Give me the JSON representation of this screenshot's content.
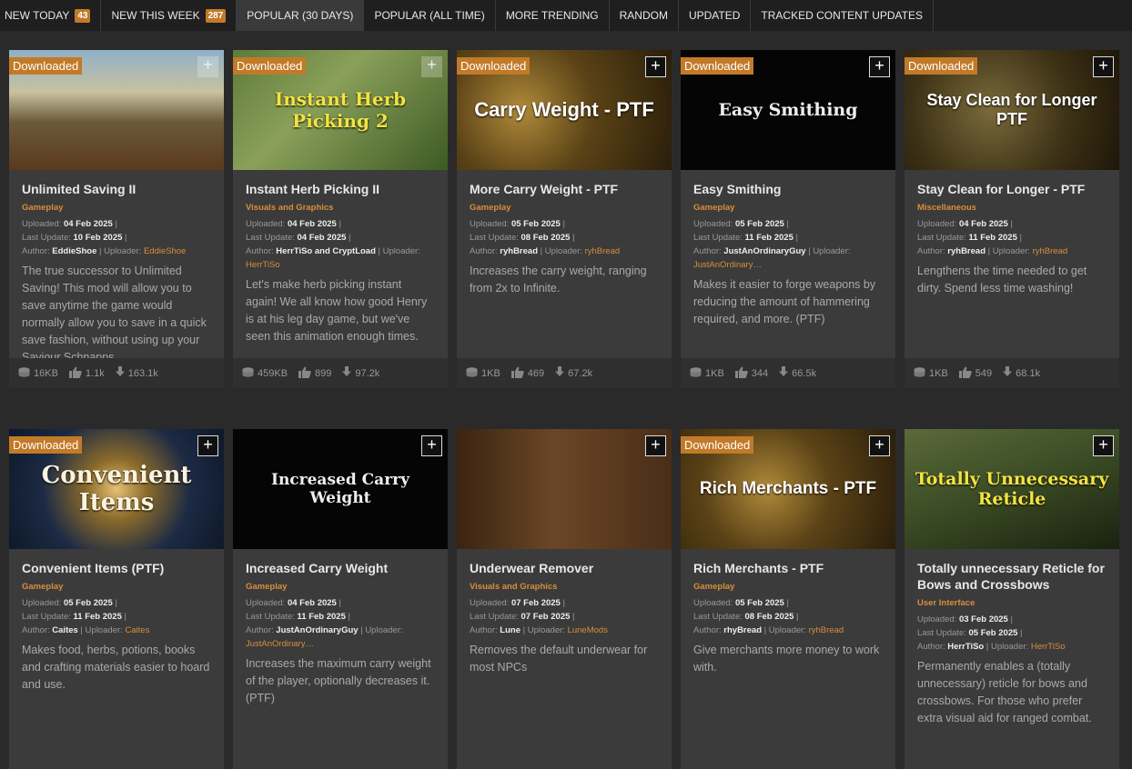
{
  "tabs": [
    {
      "label": "NEW TODAY",
      "badge": "43"
    },
    {
      "label": "NEW THIS WEEK",
      "badge": "287"
    },
    {
      "label": "POPULAR (30 DAYS)",
      "active": true
    },
    {
      "label": "POPULAR (ALL TIME)"
    },
    {
      "label": "MORE TRENDING"
    },
    {
      "label": "RANDOM"
    },
    {
      "label": "UPDATED"
    },
    {
      "label": "TRACKED CONTENT UPDATES"
    }
  ],
  "labels": {
    "downloaded": "Downloaded",
    "uploaded": "Uploaded:",
    "last_update": "Last Update:",
    "author": "Author:",
    "uploader": "Uploader:",
    "plus": "+"
  },
  "cards": [
    {
      "title": "Unlimited Saving II",
      "thumb_text": "",
      "category": "Gameplay",
      "uploaded": "04 Feb 2025",
      "updated": "10 Feb 2025",
      "author": "EddieShoe",
      "uploader": "EddieShoe",
      "desc": "The true successor to Unlimited Saving! This mod will allow you to save anytime the game would normally allow you to save in a quick save fashion, without using up your Saviour Schnapps.",
      "size": "16KB",
      "likes": "1.1k",
      "downloads": "163.1k",
      "downloaded": true
    },
    {
      "title": "Instant Herb Picking II",
      "thumb_text": "Instant Herb Picking 2",
      "category": "Visuals and Graphics",
      "uploaded": "04 Feb 2025",
      "updated": "04 Feb 2025",
      "author": "HerrTiSo and CryptLoad",
      "uploader": "HerrTiSo",
      "desc": "Let's make herb picking instant again! We all know how good Henry is at his leg day game, but we've seen this animation enough times.",
      "size": "459KB",
      "likes": "899",
      "downloads": "97.2k",
      "downloaded": true
    },
    {
      "title": "More Carry Weight - PTF",
      "thumb_text": "Carry Weight - PTF",
      "category": "Gameplay",
      "uploaded": "05 Feb 2025",
      "updated": "08 Feb 2025",
      "author": "ryhBread",
      "uploader": "ryhBread",
      "desc": "Increases the carry weight, ranging from 2x to Infinite.",
      "size": "1KB",
      "likes": "469",
      "downloads": "67.2k",
      "downloaded": true
    },
    {
      "title": "Easy Smithing",
      "thumb_text": "Easy Smithing",
      "category": "Gameplay",
      "uploaded": "05 Feb 2025",
      "updated": "11 Feb 2025",
      "author": "JustAnOrdinaryGuy",
      "uploader": "JustAnOrdinary…",
      "desc": "Makes it easier to forge weapons by reducing the amount of hammering required, and more. (PTF)",
      "size": "1KB",
      "likes": "344",
      "downloads": "66.5k",
      "downloaded": true
    },
    {
      "title": "Stay Clean for Longer - PTF",
      "thumb_text": "Stay Clean for Longer PTF",
      "category": "Miscellaneous",
      "uploaded": "04 Feb 2025",
      "updated": "11 Feb 2025",
      "author": "ryhBread",
      "uploader": "ryhBread",
      "desc": "Lengthens the time needed to get dirty. Spend less time washing!",
      "size": "1KB",
      "likes": "549",
      "downloads": "68.1k",
      "downloaded": true
    },
    {
      "title": "Convenient Items (PTF)",
      "thumb_text": "Convenient Items",
      "category": "Gameplay",
      "uploaded": "05 Feb 2025",
      "updated": "11 Feb 2025",
      "author": "Caites",
      "uploader": "Caites",
      "desc": "Makes food, herbs, potions, books and crafting materials easier to hoard and use.",
      "downloaded": true
    },
    {
      "title": "Increased Carry Weight",
      "thumb_text": "Increased Carry Weight",
      "category": "Gameplay",
      "uploaded": "04 Feb 2025",
      "updated": "11 Feb 2025",
      "author": "JustAnOrdinaryGuy",
      "uploader": "JustAnOrdinary…",
      "desc": "Increases the maximum carry weight of the player, optionally decreases it. (PTF)",
      "downloaded": false
    },
    {
      "title": "Underwear Remover",
      "thumb_text": "",
      "category": "Visuals and Graphics",
      "uploaded": "07 Feb 2025",
      "updated": "07 Feb 2025",
      "author": "Lune",
      "uploader": "LuneMods",
      "desc": "Removes the default underwear for most NPCs",
      "downloaded": false
    },
    {
      "title": "Rich Merchants - PTF",
      "thumb_text": "Rich Merchants - PTF",
      "category": "Gameplay",
      "uploaded": "05 Feb 2025",
      "updated": "08 Feb 2025",
      "author": "rhyBread",
      "uploader": "ryhBread",
      "desc": "Give merchants more money to work with.",
      "downloaded": true
    },
    {
      "title": "Totally unnecessary Reticle for Bows and Crossbows",
      "thumb_text": "Totally Unnecessary Reticle",
      "category": "User Interface",
      "uploaded": "03 Feb 2025",
      "updated": "05 Feb 2025",
      "author": "HerrTiSo",
      "uploader": "HerrTiSo",
      "desc": "Permanently enables a (totally unnecessary) reticle for bows and crossbows. For those who prefer extra visual aid for ranged combat.",
      "downloaded": false
    }
  ]
}
